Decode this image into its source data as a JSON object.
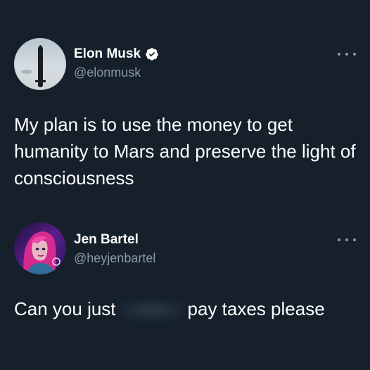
{
  "tweets": [
    {
      "display_name": "Elon Musk",
      "handle": "@elonmusk",
      "verified": true,
      "text": "My plan is to use the money to get humanity to Mars and preserve the light of consciousness",
      "avatar_icon": "starship-avatar"
    },
    {
      "display_name": "Jen Bartel",
      "handle": "@heyjenbartel",
      "verified": false,
      "text_before": "Can you just",
      "text_after": "pay taxes please",
      "avatar_icon": "illustrated-portrait-avatar"
    }
  ],
  "colors": {
    "background": "#15202b",
    "primary_text": "#ffffff",
    "secondary_text": "#8b98a5"
  }
}
